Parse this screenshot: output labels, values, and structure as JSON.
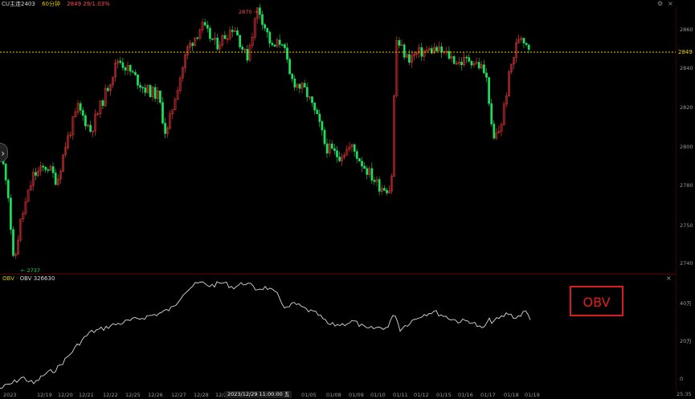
{
  "topbar": {
    "symbol": "CU主连2403",
    "period": "60分钟",
    "price": "2849 29/1.03%"
  },
  "main_chart": {
    "last_price": "2849",
    "high_label": "2870",
    "low_label": "2737",
    "price_axis": [
      "2860",
      "2840",
      "2820",
      "2800",
      "2780",
      "2750",
      "2740"
    ],
    "up_color": "#ff3b3b",
    "down_color": "#19e05a",
    "price_line_color": "#e8d000"
  },
  "obv_pane": {
    "indicator": "OBV",
    "value_label": "OBV 326630",
    "axis": [
      "40万",
      "20万",
      "0"
    ],
    "annotation": "OBV",
    "annotation_color": "#d61e1e"
  },
  "time_axis": {
    "labels": [
      "2023",
      "12/19",
      "12/20",
      "12/21",
      "12/22",
      "12/25",
      "12/26",
      "12/27",
      "12/28",
      "12/2",
      "1/04",
      "01/05",
      "01/08",
      "01/09",
      "01/10",
      "01/11",
      "01/12",
      "01/15",
      "01/16",
      "01/17",
      "01/18",
      "01/19"
    ],
    "cursor_label": "2023/12/29 11:00:00 五",
    "clock": "25:35"
  },
  "chart_data": {
    "type": "candlestick",
    "price_range": [
      2735,
      2875
    ],
    "series": [
      {
        "name": "OBV 326630",
        "y_axis_ticks": [
          "40万",
          "20万",
          "0"
        ]
      }
    ],
    "annotations": [
      "2870",
      "2737",
      "2849"
    ]
  }
}
